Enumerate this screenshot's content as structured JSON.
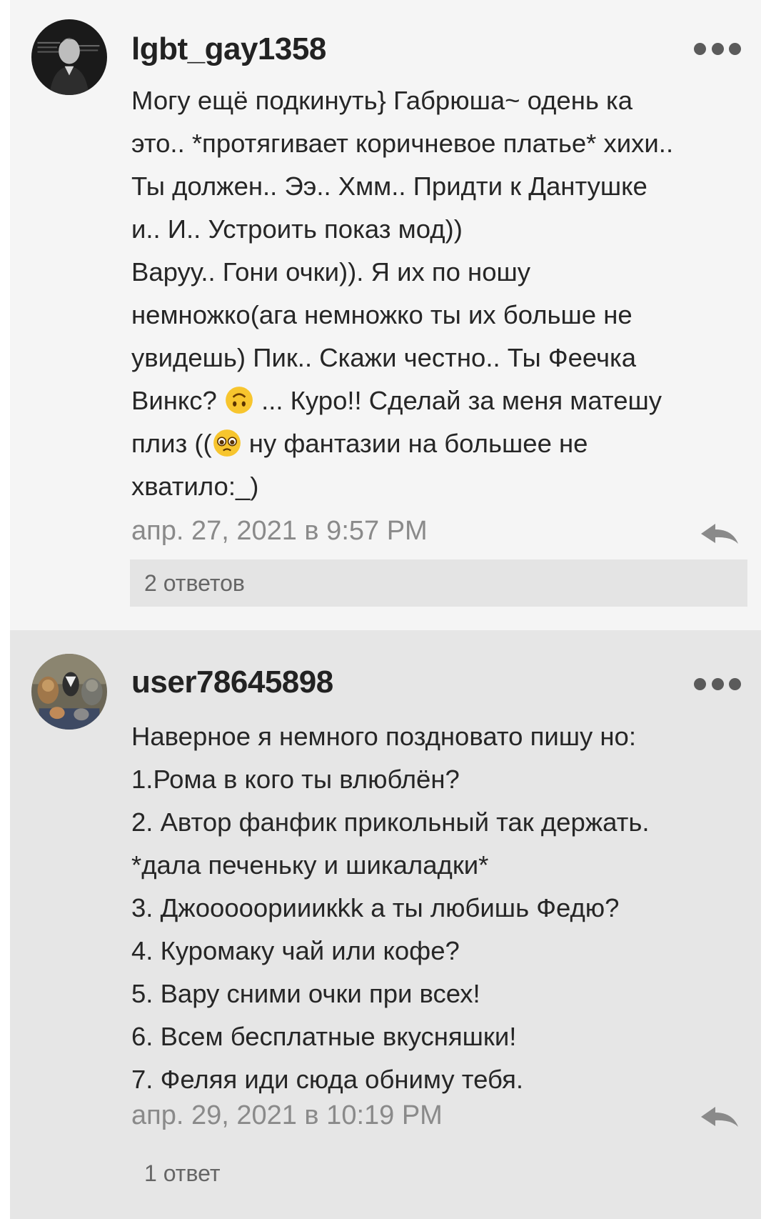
{
  "comments": [
    {
      "username": "lgbt_gay1358",
      "avatar_icon": "avatar-dark-portrait-icon",
      "lines": [
        "Могу ещё подкинуть} Габрюша~ одень ка",
        "это.. *протягивает коричневое платье* хихи..",
        "Ты должен.. Ээ.. Хмм.. Придти к Дантушке",
        "и.. И.. Устроить показ мод))",
        "Варуу.. Гони очки)). Я их по ношу",
        "немножко(ага немножко ты их больше не",
        "увидешь) Пик.. Скажи честно.. Ты Феечка"
      ],
      "line8_before": "Винкс? ",
      "line8_emoji": "upside-down-face-emoji",
      "line8_after": " ... Куро!! Сделай за меня матешу",
      "line9_before": "плиз ((",
      "line9_emoji": "pleading-face-emoji",
      "line9_after": " ну фантазии на большее не",
      "line10": "хватило:_)",
      "date": "апр. 27, 2021 в 9:57 PM",
      "replies": "2 ответов"
    },
    {
      "username": "user78645898",
      "avatar_icon": "avatar-animals-collage-icon",
      "lines": [
        "Наверное я немного поздновато пишу но:",
        "1.Рома в кого ты влюблён?",
        "2. Автор  фанфик прикольный так держать.",
        "*дала печеньку и шикаладки*",
        "3. Джооооорииикkk а ты любишь Федю?",
        "4. Куромаку чай или кофе?",
        "5. Вару сними очки при всех!",
        "6. Всем бесплатные вкусняшки!",
        "7. Феляя иди сюда обниму тебя."
      ],
      "date": "апр. 29, 2021 в 10:19 PM",
      "replies": "1 ответ"
    }
  ],
  "icons": {
    "more": "more-options-icon",
    "reply": "reply-arrow-icon"
  },
  "colors": {
    "comment_bg_1": "#f5f5f5",
    "comment_bg_2": "#e6e6e6",
    "replies_bg": "#e4e4e4",
    "date_text": "#8a8a8a",
    "body_text": "#262626"
  }
}
